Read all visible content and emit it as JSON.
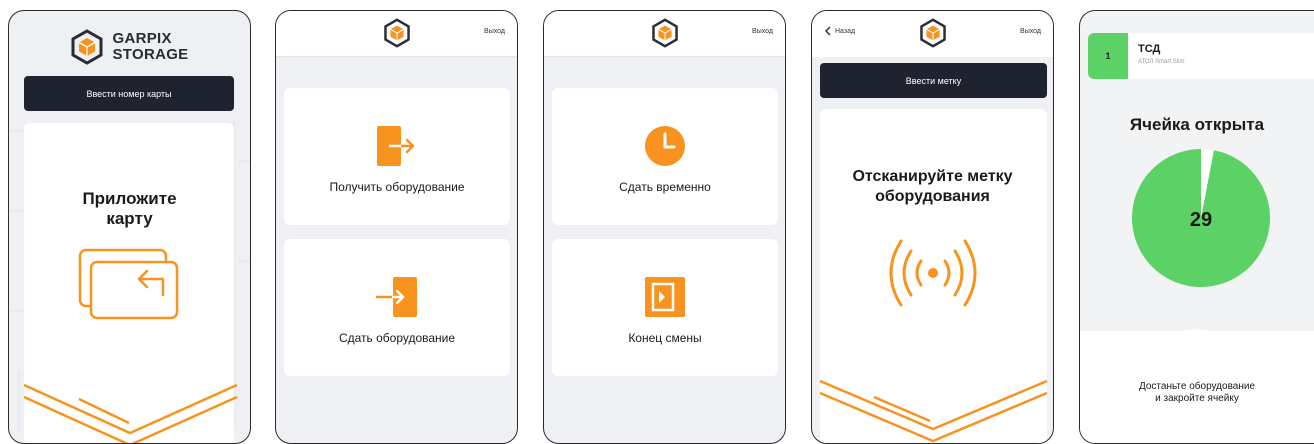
{
  "colors": {
    "accent": "#f7931e",
    "dark": "#1f2330",
    "success": "#5cd166"
  },
  "screen1": {
    "logo_line1": "GARPIX",
    "logo_line2": "STORAGE",
    "card_button": "Ввести номер карты",
    "prompt_line1": "Приложите",
    "prompt_line2": "карту"
  },
  "screen2": {
    "exit": "Выход",
    "items": [
      {
        "label": "Получить оборудование",
        "icon": "arrow-out-of-door-icon"
      },
      {
        "label": "Сдать оборудование",
        "icon": "arrow-into-door-icon"
      }
    ]
  },
  "screen3": {
    "exit": "Выход",
    "items": [
      {
        "label": "Сдать временно",
        "icon": "clock-icon"
      },
      {
        "label": "Конец смены",
        "icon": "end-shift-door-icon"
      }
    ]
  },
  "screen4": {
    "back": "Назад",
    "exit": "Выход",
    "tag_button": "Ввести метку",
    "prompt_line1": "Отсканируйте метку",
    "prompt_line2": "оборудования"
  },
  "screen5": {
    "cell_number": "1",
    "device_title": "ТСД",
    "device_sub": "АТОЛ Smart.Slim",
    "status": "Ячейка открыта",
    "timer": "29",
    "timer_fraction_remaining": 0.97,
    "instruction_line1": "Достаньте оборудование",
    "instruction_line2": "и закройте ячейку"
  }
}
